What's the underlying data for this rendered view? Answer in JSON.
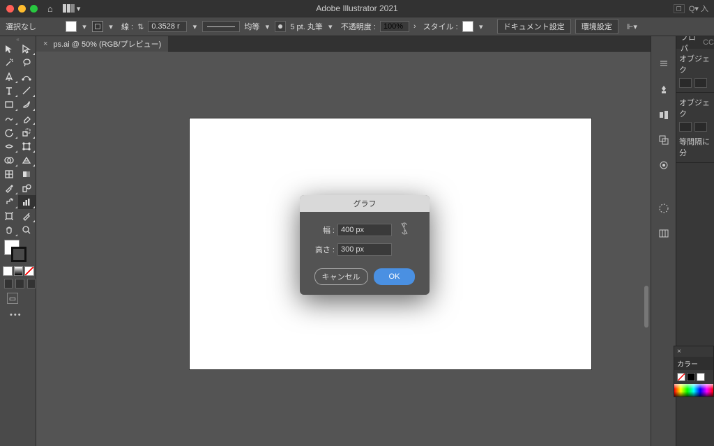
{
  "app": {
    "title": "Adobe Illustrator 2021",
    "search_hint": "入"
  },
  "ctrl": {
    "selection": "選択なし",
    "stroke_label": "線 :",
    "stroke_val": "0.3528 r",
    "uniform": "均等",
    "cap": "5 pt. 丸筆",
    "opacity_label": "不透明度 :",
    "opacity_val": "100%",
    "style_label": "スタイル :",
    "docsetup": "ドキュメント設定",
    "prefs": "環境設定"
  },
  "tab": {
    "name": "ps.ai @ 50% (RGB/プレビュー)"
  },
  "dialog": {
    "title": "グラフ",
    "width_label": "幅 :",
    "width_val": "400 px",
    "height_label": "高さ :",
    "height_val": "300 px",
    "cancel": "キャンセル",
    "ok": "OK"
  },
  "rpanel": {
    "prop_tab": "プロパ",
    "cc_tab": "CC",
    "obj1": "オブジェク",
    "obj2": "オブジェク",
    "dist": "等間隔に分"
  },
  "color": {
    "tab": "カラー"
  }
}
